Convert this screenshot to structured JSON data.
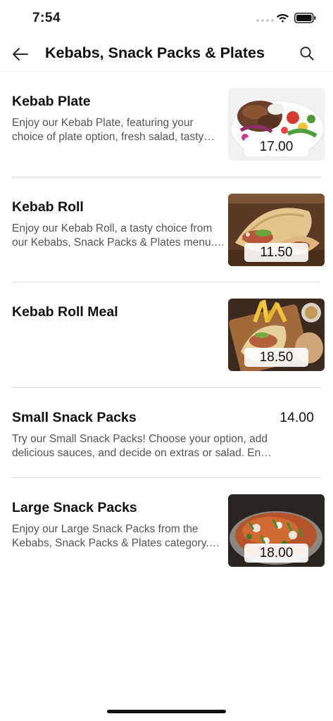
{
  "status_bar": {
    "time": "7:54"
  },
  "header": {
    "title": "Kebabs, Snack Packs & Plates"
  },
  "items": [
    {
      "name": "Kebab Plate",
      "desc_line1": "Enjoy our Kebab Plate, featuring your",
      "desc_line2": "choice of plate option, fresh salad, tasty…",
      "price": "17.00",
      "image": "kebab-plate-photo"
    },
    {
      "name": "Kebab Roll",
      "desc_line1": "Enjoy our Kebab Roll, a tasty choice from",
      "desc_line2": "our Kebabs, Snack Packs & Plates menu.…",
      "price": "11.50",
      "image": "kebab-roll-photo"
    },
    {
      "name": "Kebab Roll Meal",
      "desc_line1": "",
      "desc_line2": "",
      "price": "18.50",
      "image": "kebab-roll-meal-photo"
    },
    {
      "name": "Small Snack Packs",
      "desc_line1": "Try our Small Snack Packs! Choose your option, add",
      "desc_line2": "delicious sauces, and decide on extras or salad. En…",
      "price": "14.00",
      "image": ""
    },
    {
      "name": "Large Snack Packs",
      "desc_line1": "Enjoy our Large Snack Packs from the",
      "desc_line2": "Kebabs, Snack Packs & Plates category.…",
      "price": "18.00",
      "image": "large-snack-packs-photo"
    }
  ],
  "icons": {
    "back": "arrow-left-icon",
    "search": "search-icon",
    "wifi": "wifi-icon",
    "battery": "battery-icon"
  }
}
